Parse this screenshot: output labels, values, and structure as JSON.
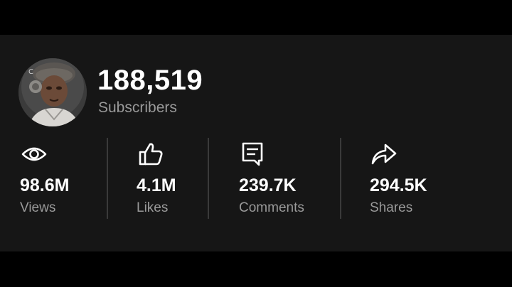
{
  "channel": {
    "subscriber_count": "188,519",
    "subscriber_label": "Subscribers",
    "avatar_icon": "profile-avatar"
  },
  "stats": [
    {
      "icon": "eye-icon",
      "value": "98.6M",
      "label": "Views"
    },
    {
      "icon": "thumbs-up-icon",
      "value": "4.1M",
      "label": "Likes"
    },
    {
      "icon": "comment-icon",
      "value": "239.7K",
      "label": "Comments"
    },
    {
      "icon": "share-arrow-icon",
      "value": "294.5K",
      "label": "Shares"
    }
  ],
  "colors": {
    "background": "#000000",
    "card": "#161616",
    "primary_text": "#ffffff",
    "secondary_text": "#9a9a9a",
    "divider": "#3a3a3a"
  }
}
